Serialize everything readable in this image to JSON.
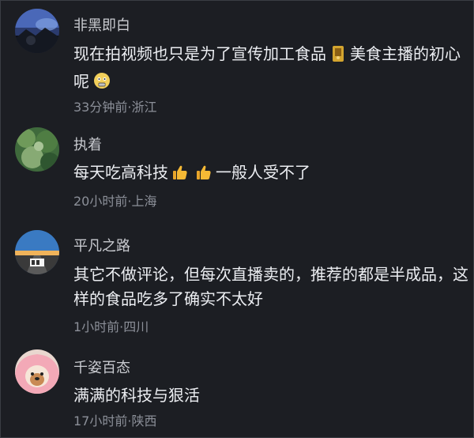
{
  "comments": [
    {
      "username": "非黑即白",
      "text_line1_part1": "现在拍视频也只是为了宣传加工食品",
      "text_line1_part2": "美食主播的初心",
      "text_line2": "呢",
      "meta": "33分钟前·浙江"
    },
    {
      "username": "执着",
      "text_part1": "每天吃高科技",
      "text_part2": "一般人受不了",
      "meta": "20小时前·上海"
    },
    {
      "username": "平凡之路",
      "text_line1": "其它不做评论，但每次直播卖的，推荐的都是半成品，这",
      "text_line2": "样的食品吃多了确实不太好",
      "meta": "1小时前·四川"
    },
    {
      "username": "千姿百态",
      "text": "满满的科技与狠活",
      "meta": "17小时前·陕西"
    }
  ]
}
